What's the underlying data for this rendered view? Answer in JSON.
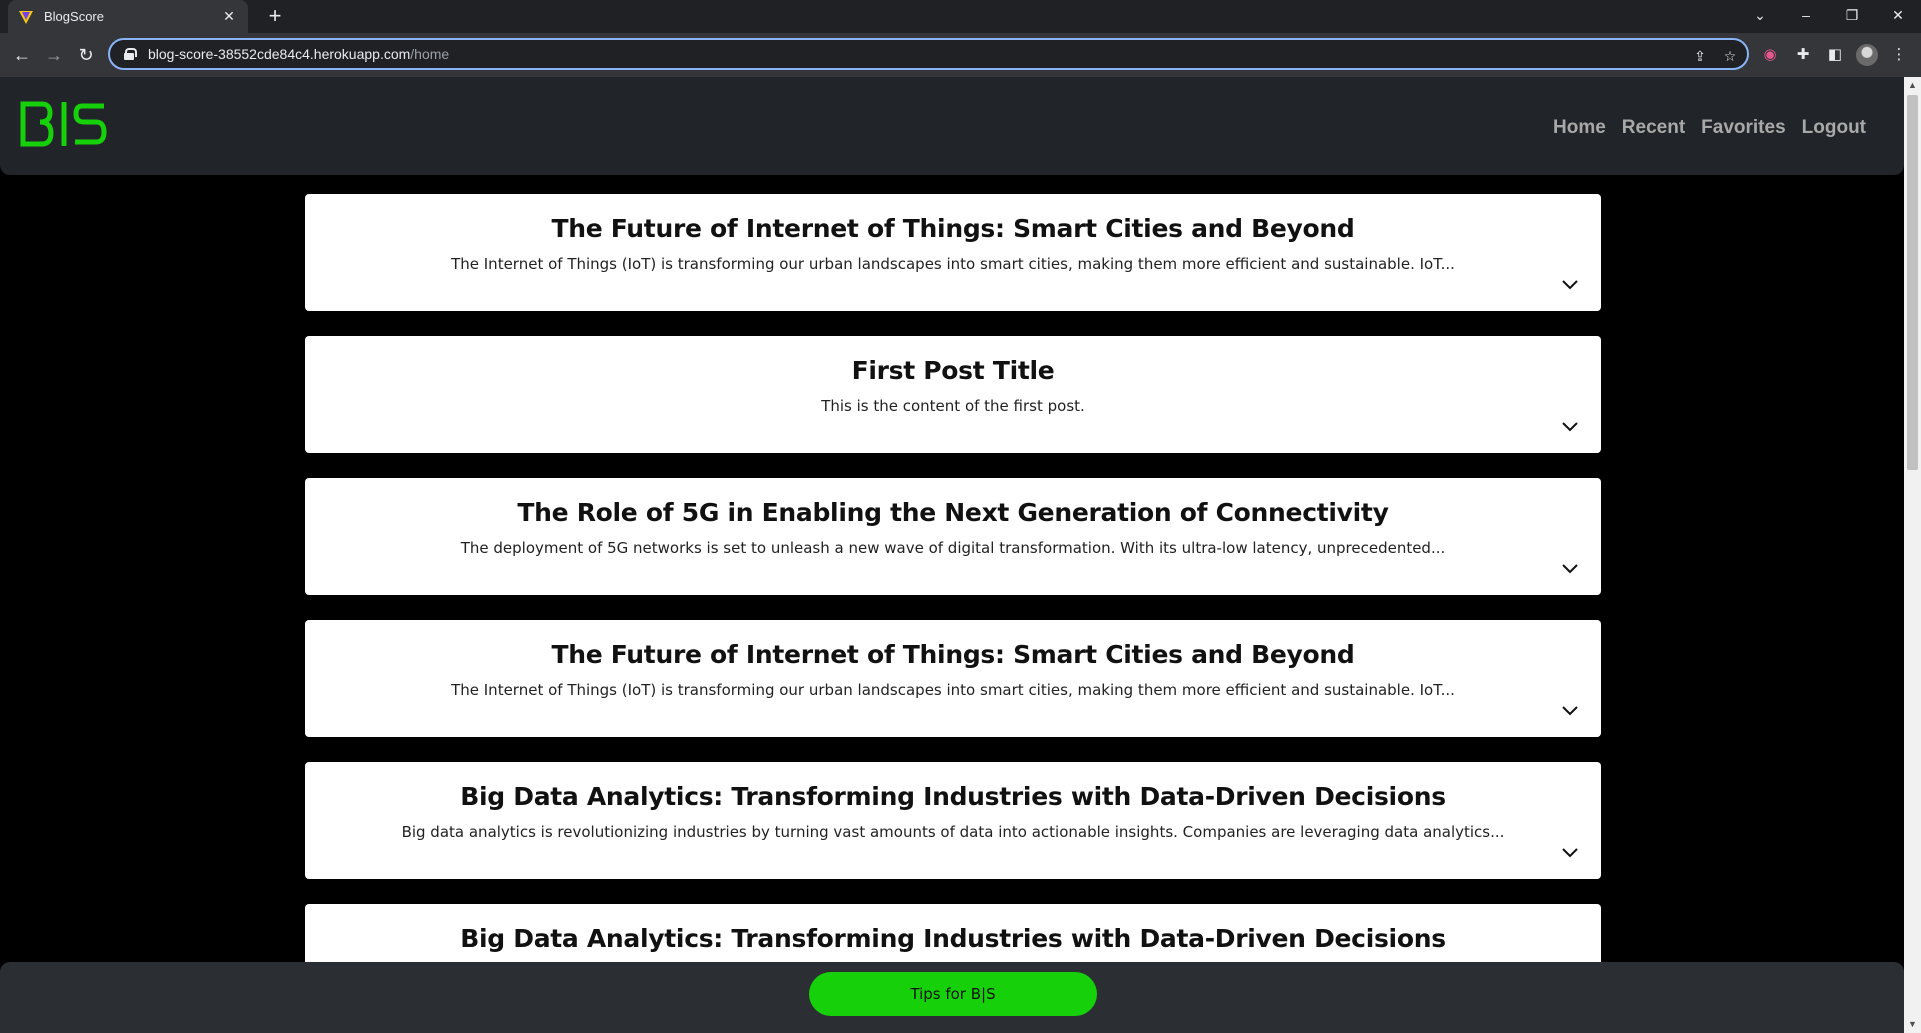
{
  "browser": {
    "tab_title": "BlogScore",
    "url_host": "blog-score-38552cde84c4.herokuapp.com",
    "url_path": "/home"
  },
  "site": {
    "logo_text": "B|S",
    "brand_color": "#16d10a",
    "nav": [
      "Home",
      "Recent",
      "Favorites",
      "Logout"
    ]
  },
  "posts": [
    {
      "title": "The Future of Internet of Things: Smart Cities and Beyond",
      "excerpt": "The Internet of Things (IoT) is transforming our urban landscapes into smart cities, making them more efficient and sustainable. IoT..."
    },
    {
      "title": "First Post Title",
      "excerpt": "This is the content of the first post."
    },
    {
      "title": "The Role of 5G in Enabling the Next Generation of Connectivity",
      "excerpt": "The deployment of 5G networks is set to unleash a new wave of digital transformation. With its ultra-low latency, unprecedented..."
    },
    {
      "title": "The Future of Internet of Things: Smart Cities and Beyond",
      "excerpt": "The Internet of Things (IoT) is transforming our urban landscapes into smart cities, making them more efficient and sustainable. IoT..."
    },
    {
      "title": "Big Data Analytics: Transforming Industries with Data-Driven Decisions",
      "excerpt": "Big data analytics is revolutionizing industries by turning vast amounts of data into actionable insights. Companies are leveraging data analytics..."
    },
    {
      "title": "Big Data Analytics: Transforming Industries with Data-Driven Decisions",
      "excerpt": ""
    }
  ],
  "footer": {
    "tips_label": "Tips for B|S"
  }
}
